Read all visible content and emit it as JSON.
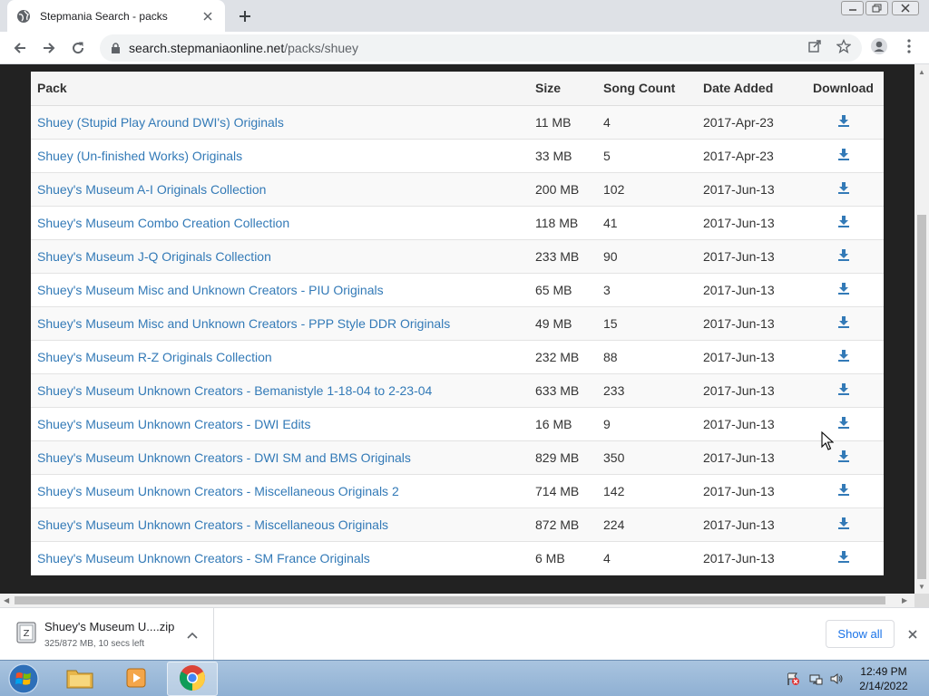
{
  "browser": {
    "tab_title": "Stepmania Search - packs",
    "url_host": "search.stepmaniaonline.net",
    "url_path": "/packs/shuey"
  },
  "table": {
    "headers": [
      "Pack",
      "Size",
      "Song Count",
      "Date Added",
      "Download"
    ],
    "rows": [
      {
        "pack": "Shuey (Stupid Play Around DWI's) Originals",
        "size": "11 MB",
        "count": "4",
        "date": "2017-Apr-23"
      },
      {
        "pack": "Shuey (Un-finished Works) Originals",
        "size": "33 MB",
        "count": "5",
        "date": "2017-Apr-23"
      },
      {
        "pack": "Shuey's Museum A-I Originals Collection",
        "size": "200 MB",
        "count": "102",
        "date": "2017-Jun-13"
      },
      {
        "pack": "Shuey's Museum Combo Creation Collection",
        "size": "118 MB",
        "count": "41",
        "date": "2017-Jun-13"
      },
      {
        "pack": "Shuey's Museum J-Q Originals Collection",
        "size": "233 MB",
        "count": "90",
        "date": "2017-Jun-13"
      },
      {
        "pack": "Shuey's Museum Misc and Unknown Creators - PIU Originals",
        "size": "65 MB",
        "count": "3",
        "date": "2017-Jun-13"
      },
      {
        "pack": "Shuey's Museum Misc and Unknown Creators - PPP Style DDR Originals",
        "size": "49 MB",
        "count": "15",
        "date": "2017-Jun-13"
      },
      {
        "pack": "Shuey's Museum R-Z Originals Collection",
        "size": "232 MB",
        "count": "88",
        "date": "2017-Jun-13"
      },
      {
        "pack": "Shuey's Museum Unknown Creators - Bemanistyle 1-18-04 to 2-23-04",
        "size": "633 MB",
        "count": "233",
        "date": "2017-Jun-13"
      },
      {
        "pack": "Shuey's Museum Unknown Creators - DWI Edits",
        "size": "16 MB",
        "count": "9",
        "date": "2017-Jun-13"
      },
      {
        "pack": "Shuey's Museum Unknown Creators - DWI SM and BMS Originals",
        "size": "829 MB",
        "count": "350",
        "date": "2017-Jun-13"
      },
      {
        "pack": "Shuey's Museum Unknown Creators - Miscellaneous Originals 2",
        "size": "714 MB",
        "count": "142",
        "date": "2017-Jun-13"
      },
      {
        "pack": "Shuey's Museum Unknown Creators - Miscellaneous Originals",
        "size": "872 MB",
        "count": "224",
        "date": "2017-Jun-13"
      },
      {
        "pack": "Shuey's Museum Unknown Creators - SM France Originals",
        "size": "6 MB",
        "count": "4",
        "date": "2017-Jun-13"
      }
    ]
  },
  "download_shelf": {
    "file_name": "Shuey's Museum U....zip",
    "status": "325/872 MB, 10 secs left",
    "show_all": "Show all"
  },
  "taskbar": {
    "time": "12:49 PM",
    "date": "2/14/2022"
  },
  "colors": {
    "link": "#337ab7",
    "page_bg": "#222222",
    "chrome_tabbar": "#dee1e6",
    "taskbar": "#9dbbd9"
  }
}
